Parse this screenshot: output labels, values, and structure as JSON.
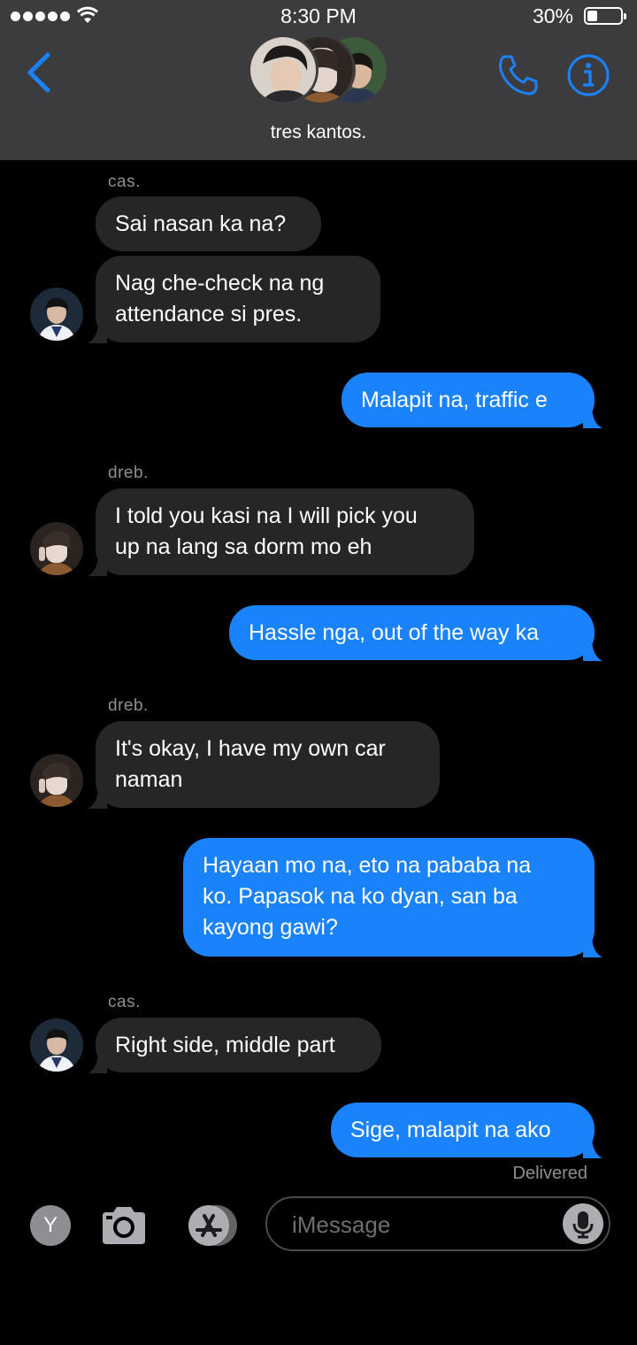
{
  "status_bar": {
    "time": "8:30 PM",
    "battery": "30%",
    "battery_level": 0.3
  },
  "header": {
    "group_name": "tres kantos."
  },
  "messages": [
    {
      "sender": "cas.",
      "texts": [
        "Sai nasan ka na?",
        "Nag che-check na ng",
        "attendance si pres."
      ]
    },
    {
      "text": "Malapit na, traffic e"
    },
    {
      "sender": "dreb.",
      "lines": [
        "I told you kasi na I will pick you",
        "up na lang sa dorm mo eh"
      ]
    },
    {
      "text": "Hassle nga, out of the way ka"
    },
    {
      "sender": "dreb.",
      "lines": [
        "It's okay, I have my own car",
        "naman"
      ]
    },
    {
      "lines": [
        "Hayaan mo na, eto na pababa na",
        "ko. Papasok na ko dyan, san ba",
        "kayong gawi?"
      ]
    },
    {
      "sender": "cas.",
      "text": "Right side, middle part"
    },
    {
      "text": "Sige, malapit na ako"
    }
  ],
  "delivered": "Delivered",
  "input_bar": {
    "app_label": "Y",
    "placeholder": "iMessage"
  },
  "colors": {
    "header_bg": "#3c3c3e",
    "incoming": "#262628",
    "outgoing": "#1a82fb",
    "accent": "#1a82fb"
  },
  "icons": [
    "back-chevron-icon",
    "phone-icon",
    "info-icon",
    "camera-icon",
    "app-store-icon",
    "microphone-icon",
    "wifi-icon",
    "battery-icon"
  ]
}
